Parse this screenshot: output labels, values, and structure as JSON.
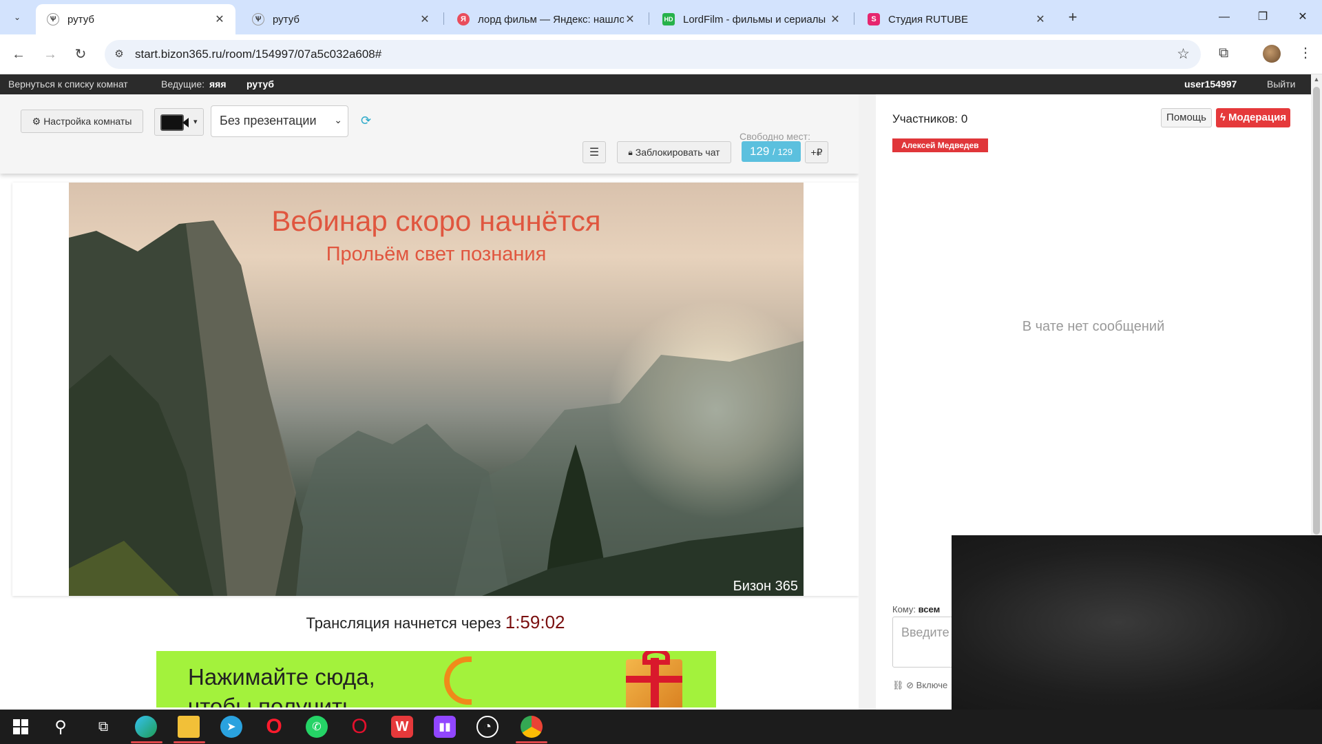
{
  "browser": {
    "tabs": [
      {
        "title": "рутуб",
        "active": true,
        "icon": "bizon-icon"
      },
      {
        "title": "рутуб",
        "active": false,
        "icon": "bizon-icon"
      },
      {
        "title": "лорд фильм — Яндекс: нашло",
        "active": false,
        "icon": "yandex-icon"
      },
      {
        "title": "LordFilm - фильмы и сериалы",
        "active": false,
        "icon": "hd-icon"
      },
      {
        "title": "Студия RUTUBE",
        "active": false,
        "icon": "rutube-icon"
      }
    ],
    "url": "start.bizon365.ru/room/154997/07a5c032a608#"
  },
  "appbar": {
    "back_link": "Вернуться к списку комнат",
    "host_label": "Ведущие:",
    "host_name": "яяя",
    "room_name": "рутуб",
    "username": "user154997",
    "logout": "Выйти"
  },
  "controls": {
    "settings_label": "Настройка комнаты",
    "presentation_select": "Без презентации",
    "block_chat_label": "Заблокировать чат",
    "free_seats_label": "Свободно мест:",
    "seats_free": "129",
    "seats_total": "/ 129",
    "add_ruble_label": "+₽"
  },
  "video": {
    "title": "Вебинар скоро начнётся",
    "subtitle": "Прольём свет познания",
    "watermark": "Бизон 365"
  },
  "countdown": {
    "label": "Трансляция начнется через",
    "time": "1:59:02"
  },
  "banner": {
    "line1": "Нажимайте сюда,",
    "line2": "чтобы получить"
  },
  "chat": {
    "participants": "Участников: 0",
    "help": "Помощь",
    "moderation": "Модерация",
    "user_badge": "Алексей Медведев",
    "empty": "В чате нет сообщений",
    "to_label": "Кому:",
    "to_value": "всем",
    "input_placeholder": "Введите",
    "toggle_label": "Включе"
  },
  "colors": {
    "accent_red": "#e5393b",
    "seats_blue": "#5bc0de",
    "banner_green": "#a3f23c",
    "video_title": "#e0563f"
  }
}
